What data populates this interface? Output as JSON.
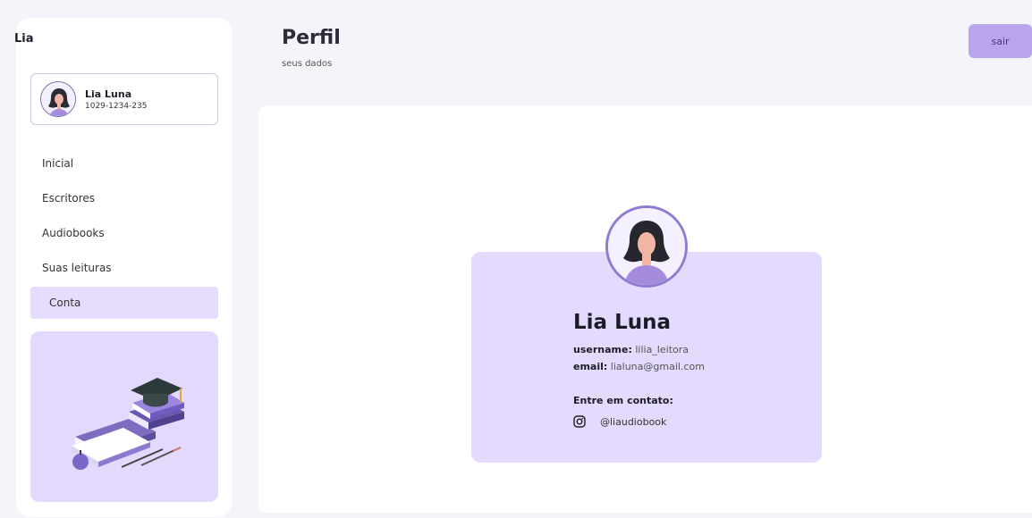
{
  "app": {
    "title": "Lia"
  },
  "user_card": {
    "name": "Lia Luna",
    "id": "1029-1234-235"
  },
  "nav": {
    "items": [
      {
        "label": "Inicial"
      },
      {
        "label": "Escritores"
      },
      {
        "label": "Audiobooks"
      },
      {
        "label": "Suas leituras"
      },
      {
        "label": "Conta",
        "active": true
      }
    ]
  },
  "header": {
    "title": "Perfil",
    "subtitle": "seus dados",
    "logout_label": "sair"
  },
  "profile": {
    "name": "Lia Luna",
    "username_label": "username:",
    "username": "lilia_leitora",
    "email_label": "email:",
    "email": "lialuna@gmail.com",
    "contact_title": "Entre em contato:",
    "instagram": "@liaudiobook",
    "contact_icon": "instagram-icon"
  },
  "colors": {
    "accent": "#b9a4ef",
    "card_bg": "#e3dafd",
    "active_nav": "#e5dcfe",
    "background": "#f4f4fa"
  }
}
